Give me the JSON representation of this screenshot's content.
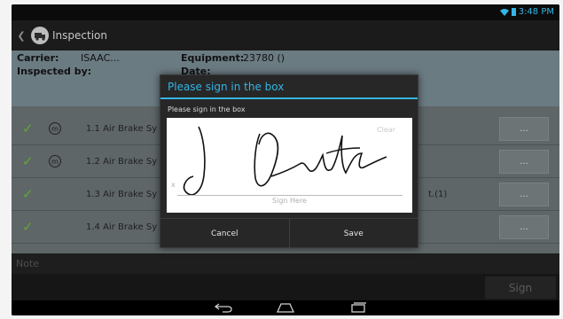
{
  "status": {
    "time": "3:48 PM"
  },
  "actionbar": {
    "title": "Inspection"
  },
  "info": {
    "carrier_label": "Carrier:",
    "carrier_value": "ISAAC...",
    "inspected_by_label": "Inspected by:",
    "equipment_label": "Equipment:",
    "equipment_value": "23780 ()",
    "date_label": "Date:"
  },
  "list": {
    "rows": [
      {
        "label": "1.1 Air Brake Sy",
        "checked": true,
        "m": true,
        "extra": "",
        "button": "..."
      },
      {
        "label": "1.2 Air Brake Sy",
        "checked": true,
        "m": true,
        "extra": "",
        "button": "..."
      },
      {
        "label": "1.3 Air Brake Sy",
        "checked": true,
        "m": false,
        "extra": "t.(1)",
        "button": "..."
      },
      {
        "label": "1.4 Air Brake Sy",
        "checked": true,
        "m": false,
        "extra": "",
        "button": "..."
      }
    ]
  },
  "note": {
    "placeholder": "Note"
  },
  "sign_button": "Sign",
  "dialog": {
    "title": "Please sign in the box",
    "subtitle": "Please sign in the box",
    "clear_label": "Clear",
    "x_mark": "x",
    "sign_here": "Sign Here",
    "cancel_label": "Cancel",
    "save_label": "Save"
  },
  "colors": {
    "accent": "#33b5e5",
    "check": "#5fa832"
  },
  "icons": {
    "back": "chevron-left-icon",
    "app": "inspection-app-icon",
    "wifi": "wifi-icon",
    "battery": "battery-icon",
    "check": "checkmark-icon",
    "m": "m-circle-icon",
    "nav_back": "back-icon",
    "nav_home": "home-icon",
    "nav_recents": "recents-icon"
  }
}
